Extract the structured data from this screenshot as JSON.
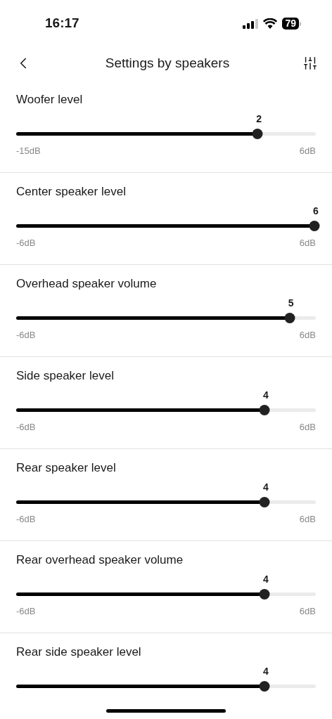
{
  "status_bar": {
    "time": "16:17",
    "battery": "79"
  },
  "header": {
    "title": "Settings by speakers"
  },
  "sliders": [
    {
      "label": "Woofer level",
      "value": "2",
      "level": 0.81,
      "min": "-15dB",
      "max": "6dB"
    },
    {
      "label": "Center speaker level",
      "value": "6",
      "level": 1.0,
      "min": "-6dB",
      "max": "6dB"
    },
    {
      "label": "Overhead speaker volume",
      "value": "5",
      "level": 0.917,
      "min": "-6dB",
      "max": "6dB"
    },
    {
      "label": "Side speaker level",
      "value": "4",
      "level": 0.833,
      "min": "-6dB",
      "max": "6dB"
    },
    {
      "label": "Rear speaker level",
      "value": "4",
      "level": 0.833,
      "min": "-6dB",
      "max": "6dB"
    },
    {
      "label": "Rear overhead speaker volume",
      "value": "4",
      "level": 0.833,
      "min": "-6dB",
      "max": "6dB"
    },
    {
      "label": "Rear side speaker level",
      "value": "4",
      "level": 0.833
    }
  ]
}
